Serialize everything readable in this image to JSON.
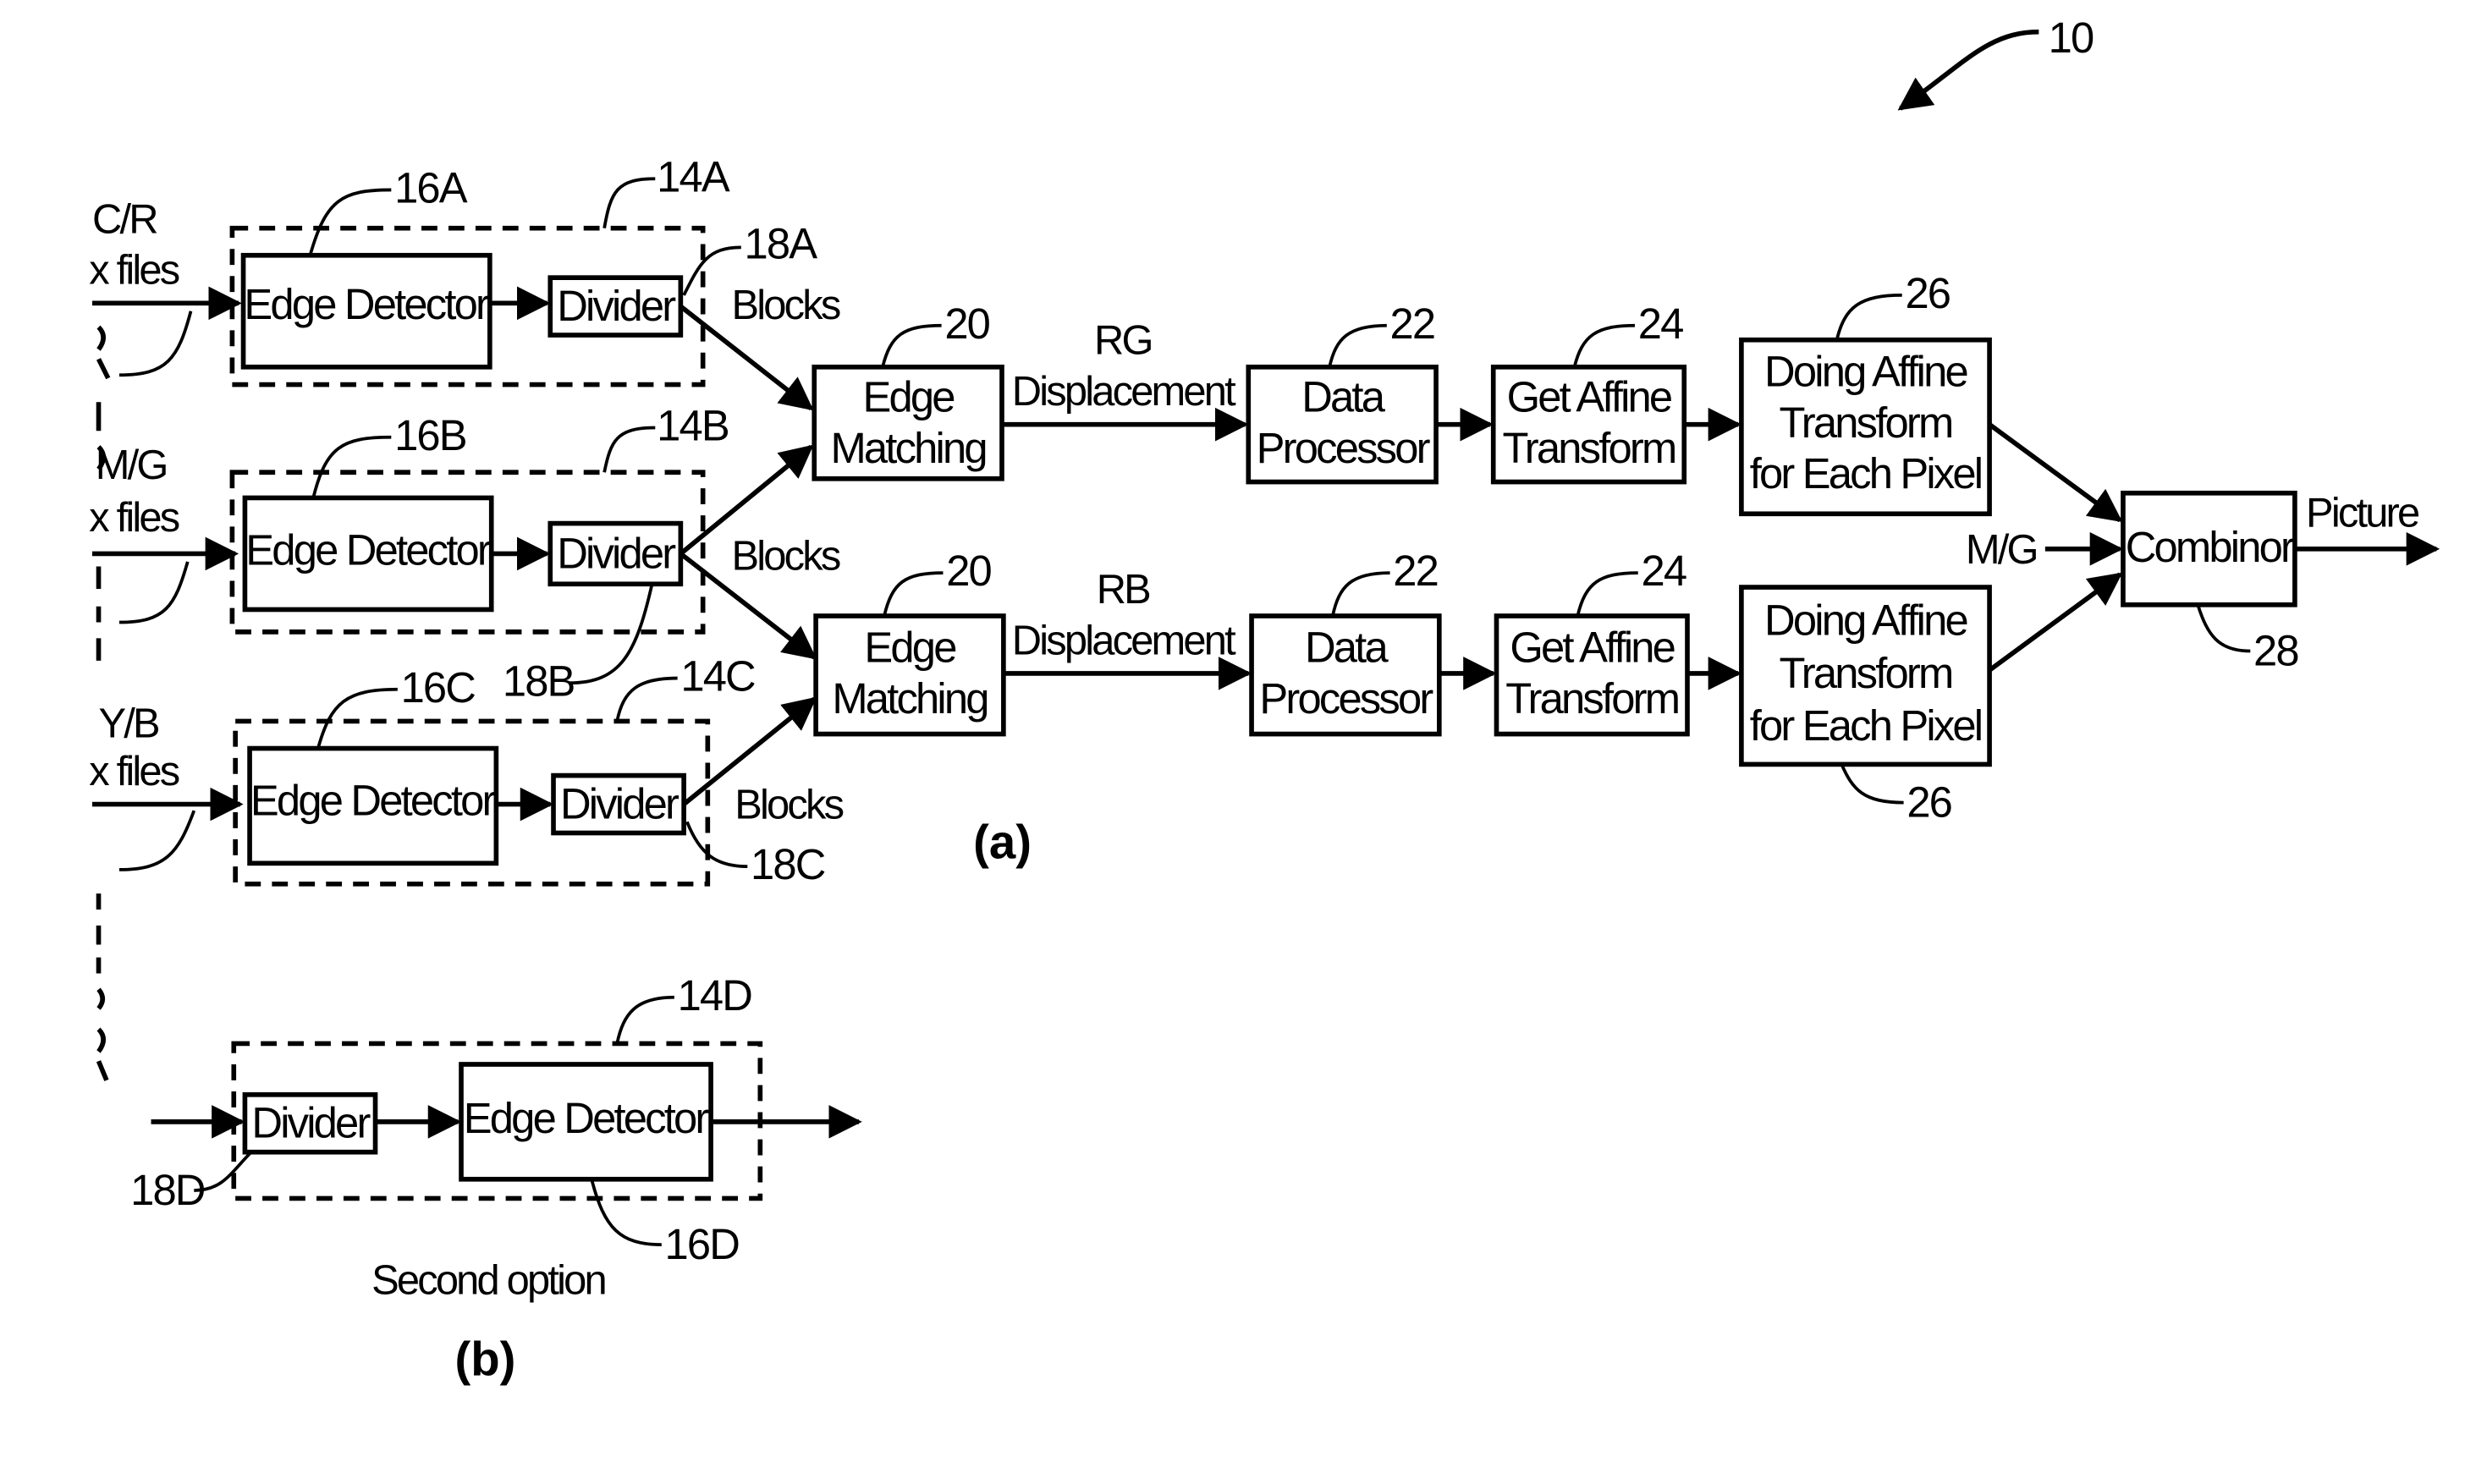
{
  "figure": {
    "reference_numeral": "10",
    "caption_a": "(a)",
    "caption_b": "(b)",
    "second_option_label": "Second option"
  },
  "inputs": [
    {
      "channel": "C/R",
      "files": "x files"
    },
    {
      "channel": "M/G",
      "files": "x files"
    },
    {
      "channel": "Y/B",
      "files": "x files"
    }
  ],
  "preprocess_groups": [
    {
      "group_ref": "14A",
      "edge_detector_ref": "16A",
      "divider_ref": "18A",
      "edge_detector_label": "Edge Detector",
      "divider_label": "Divider",
      "output_label": "Blocks"
    },
    {
      "group_ref": "14B",
      "edge_detector_ref": "16B",
      "divider_ref": "18B",
      "edge_detector_label": "Edge Detector",
      "divider_label": "Divider",
      "output_label": "Blocks"
    },
    {
      "group_ref": "14C",
      "edge_detector_ref": "16C",
      "divider_ref": "18C",
      "edge_detector_label": "Edge Detector",
      "divider_label": "Divider",
      "output_label": "Blocks"
    }
  ],
  "pipelines": [
    {
      "edge_matching": {
        "ref": "20",
        "line1": "Edge",
        "line2": "Matching"
      },
      "displacement": {
        "line1": "RG",
        "line2": "Displacement"
      },
      "data_processor": {
        "ref": "22",
        "line1": "Data",
        "line2": "Processor"
      },
      "get_affine": {
        "ref": "24",
        "line1": "Get Affine",
        "line2": "Transform"
      },
      "doing_affine": {
        "ref": "26",
        "line1": "Doing Affine",
        "line2": "Transform",
        "line3": "for Each Pixel"
      }
    },
    {
      "edge_matching": {
        "ref": "20",
        "line1": "Edge",
        "line2": "Matching"
      },
      "displacement": {
        "line1": "RB",
        "line2": "Displacement"
      },
      "data_processor": {
        "ref": "22",
        "line1": "Data",
        "line2": "Processor"
      },
      "get_affine": {
        "ref": "24",
        "line1": "Get Affine",
        "line2": "Transform"
      },
      "doing_affine": {
        "ref": "26",
        "line1": "Doing Affine",
        "line2": "Transform",
        "line3": "for Each Pixel"
      }
    }
  ],
  "combiner": {
    "ref": "28",
    "label": "Combinor",
    "side_input": "M/G",
    "output": "Picture"
  },
  "second_option": {
    "group_ref": "14D",
    "divider_ref": "18D",
    "edge_detector_ref": "16D",
    "divider_label": "Divider",
    "edge_detector_label": "Edge Detector"
  }
}
